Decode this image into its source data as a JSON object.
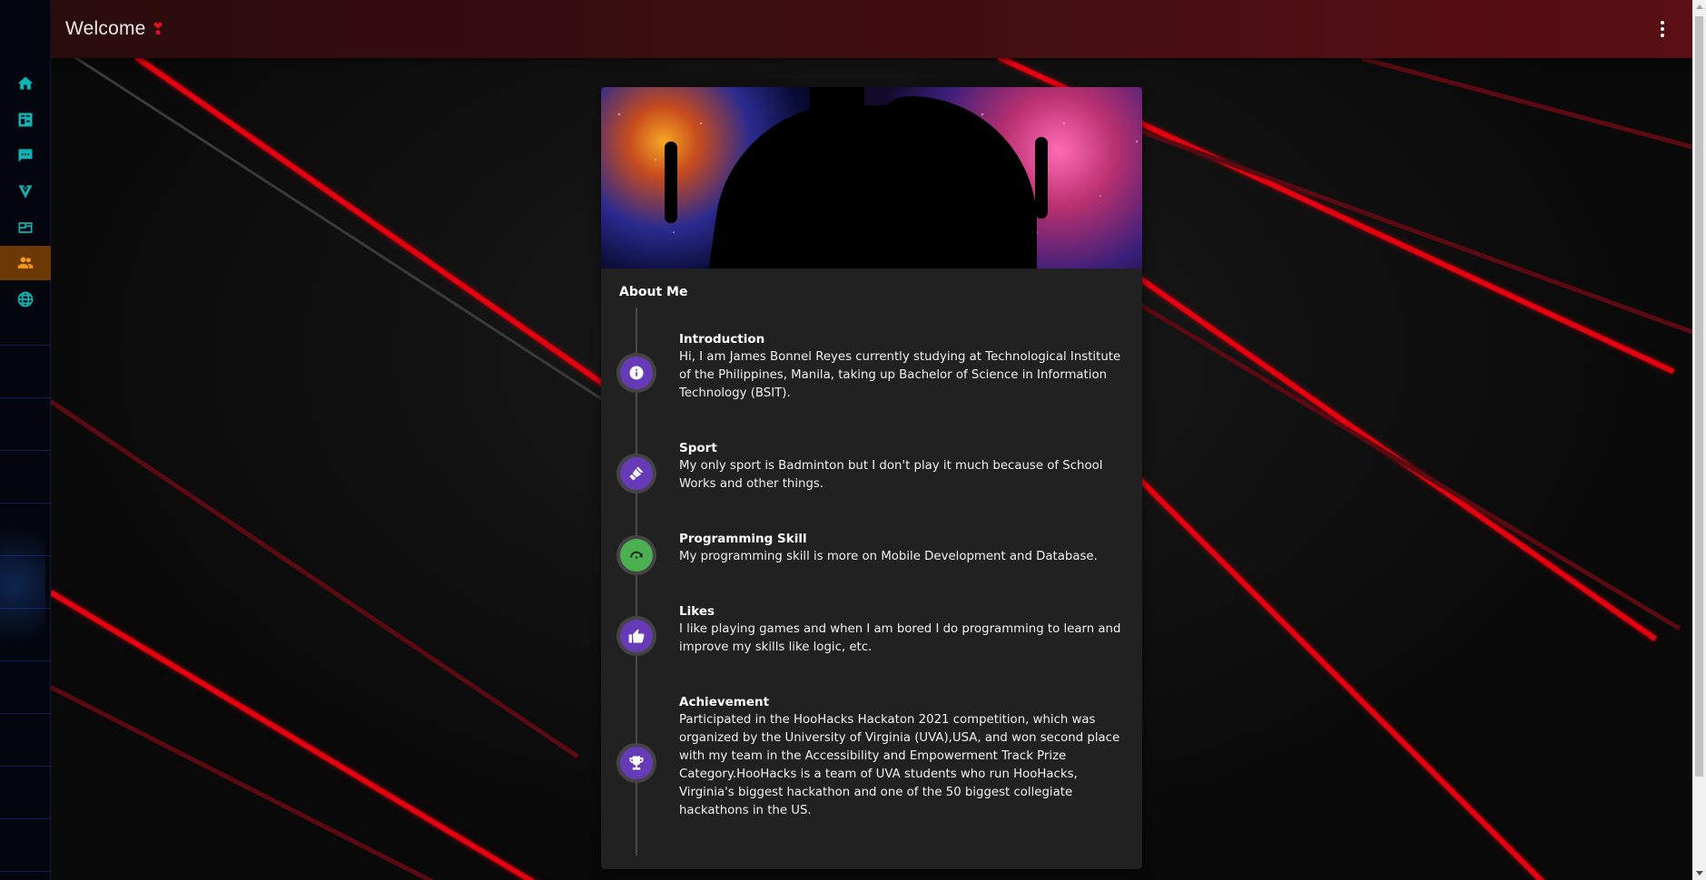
{
  "appbar": {
    "title": "Welcome",
    "heart_icon": "❣"
  },
  "nav": {
    "items": [
      {
        "icon": "home-icon",
        "active": false
      },
      {
        "icon": "calculator-icon",
        "active": false
      },
      {
        "icon": "chat-icon",
        "active": false
      },
      {
        "icon": "vuetify-icon",
        "active": false
      },
      {
        "icon": "newspaper-icon",
        "active": false
      },
      {
        "icon": "account-group-icon",
        "active": true
      },
      {
        "icon": "web-icon",
        "active": false
      }
    ],
    "colors": {
      "icon": "#0fb3b3",
      "active_icon": "#f39a1a",
      "active_bg": "#6b3806"
    }
  },
  "card": {
    "section_title": "About Me",
    "timeline": [
      {
        "icon": "information-icon",
        "color": "#673ab7",
        "heading": "Introduction",
        "text": "Hi, I am James Bonnel Reyes currently studying at Technological Institute of the Philippines, Manila, taking up Bachelor of Science in Information Technology (BSIT)."
      },
      {
        "icon": "badminton-icon",
        "color": "#673ab7",
        "heading": "Sport",
        "text": "My only sport is Badminton but I don't play it much because of School Works and other things."
      },
      {
        "icon": "rotate-arrow-icon",
        "color": "#4caf50",
        "heading": "Programming Skill",
        "text": "My programming skill is more on Mobile Development and Database."
      },
      {
        "icon": "thumb-up-icon",
        "color": "#673ab7",
        "heading": "Likes",
        "text": "I like playing games and when I am bored I do programming to learn and improve my skills like logic, etc."
      },
      {
        "icon": "trophy-icon",
        "color": "#673ab7",
        "heading": "Achievement",
        "text": "Participated in the HooHacks Hackaton 2021 competition, which was organized by the University of Virginia (UVA),USA, and won second place with my team in the Accessibility and Empowerment Track Prize Category.HooHacks is a team of UVA students who run HooHacks, Virginia's biggest hackathon and one of the 50 biggest collegiate hackathons in the US."
      }
    ]
  }
}
